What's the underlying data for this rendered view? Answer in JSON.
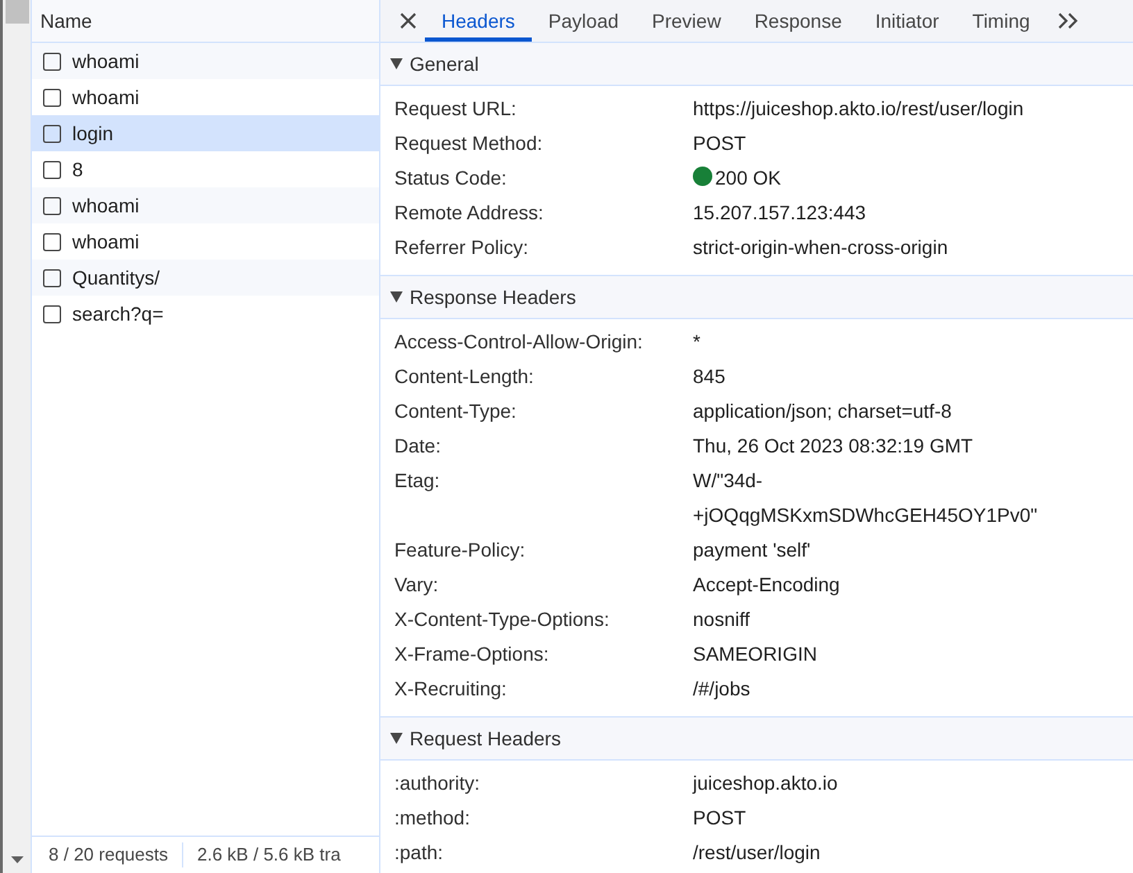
{
  "request_list": {
    "column": "Name",
    "items": [
      {
        "name": "whoami",
        "checked": false,
        "selected": false
      },
      {
        "name": "whoami",
        "checked": false,
        "selected": false
      },
      {
        "name": "login",
        "checked": false,
        "selected": true
      },
      {
        "name": "8",
        "checked": false,
        "selected": false
      },
      {
        "name": "whoami",
        "checked": false,
        "selected": false
      },
      {
        "name": "whoami",
        "checked": false,
        "selected": false
      },
      {
        "name": "Quantitys/",
        "checked": false,
        "selected": false
      },
      {
        "name": "search?q=",
        "checked": false,
        "selected": false
      }
    ]
  },
  "status_bar": {
    "items": [
      "8 / 20 requests",
      "2.6 kB / 5.6 kB tra"
    ]
  },
  "details": {
    "tabs": [
      {
        "label": "Headers",
        "selected": true
      },
      {
        "label": "Payload",
        "selected": false
      },
      {
        "label": "Preview",
        "selected": false
      },
      {
        "label": "Response",
        "selected": false
      },
      {
        "label": "Initiator",
        "selected": false
      },
      {
        "label": "Timing",
        "selected": false
      }
    ],
    "sections": [
      {
        "title": "General",
        "expanded": true,
        "rows": [
          {
            "kind": "text",
            "name": "Request URL:",
            "value": "https://juiceshop.akto.io/rest/user/login"
          },
          {
            "kind": "text",
            "name": "Request Method:",
            "value": "POST"
          },
          {
            "kind": "status",
            "name": "Status Code:",
            "value": "200 OK",
            "color": "#188038"
          },
          {
            "kind": "text",
            "name": "Remote Address:",
            "value": "15.207.157.123:443"
          },
          {
            "kind": "text",
            "name": "Referrer Policy:",
            "value": "strict-origin-when-cross-origin"
          }
        ]
      },
      {
        "title": "Response Headers",
        "expanded": true,
        "rows": [
          {
            "kind": "text",
            "name": "Access-Control-Allow-Origin:",
            "value": "*"
          },
          {
            "kind": "text",
            "name": "Content-Length:",
            "value": "845"
          },
          {
            "kind": "text",
            "name": "Content-Type:",
            "value": "application/json; charset=utf-8"
          },
          {
            "kind": "text",
            "name": "Date:",
            "value": "Thu, 26 Oct 2023 08:32:19 GMT"
          },
          {
            "kind": "text",
            "name": "Etag:",
            "value": "W/\"34d-+jOQqgMSKxmSDWhcGEH45OY1Pv0\""
          },
          {
            "kind": "text",
            "name": "Feature-Policy:",
            "value": "payment 'self'"
          },
          {
            "kind": "text",
            "name": "Vary:",
            "value": "Accept-Encoding"
          },
          {
            "kind": "text",
            "name": "X-Content-Type-Options:",
            "value": "nosniff"
          },
          {
            "kind": "text",
            "name": "X-Frame-Options:",
            "value": "SAMEORIGIN"
          },
          {
            "kind": "text",
            "name": "X-Recruiting:",
            "value": "/#/jobs"
          }
        ]
      },
      {
        "title": "Request Headers",
        "expanded": true,
        "rows": [
          {
            "kind": "text",
            "name": ":authority:",
            "value": "juiceshop.akto.io"
          },
          {
            "kind": "text",
            "name": ":method:",
            "value": "POST"
          },
          {
            "kind": "text",
            "name": ":path:",
            "value": "/rest/user/login"
          }
        ]
      }
    ]
  }
}
